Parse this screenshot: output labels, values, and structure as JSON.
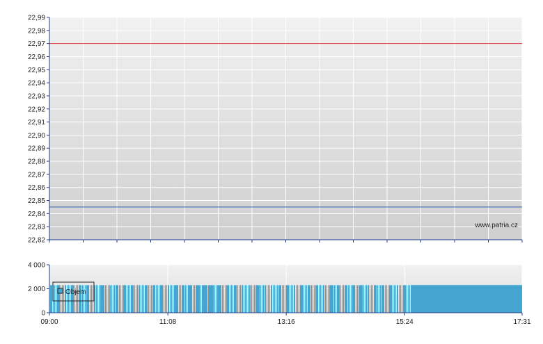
{
  "colors": {
    "price_line": "#2a64a8",
    "reference_line": "#e03030",
    "volume_bar": "#45a5cf",
    "axis": "#1d3c8c",
    "plot_bg_top": "#f1f1f1",
    "plot_bg_bottom": "#cfcfcf",
    "grid": "#ffffff"
  },
  "chart_data": [
    {
      "type": "line",
      "title": "",
      "xlabel": "",
      "ylabel": "",
      "ylim": [
        22.82,
        22.99
      ],
      "y_ticks": [
        "22,99",
        "22,98",
        "22,97",
        "22,96",
        "22,95",
        "22,94",
        "22,93",
        "22,92",
        "22,91",
        "22,90",
        "22,89",
        "22,88",
        "22,87",
        "22,86",
        "22,85",
        "22,84",
        "22,83",
        "22,82"
      ],
      "y_tick_values": [
        22.99,
        22.98,
        22.97,
        22.96,
        22.95,
        22.94,
        22.93,
        22.92,
        22.91,
        22.9,
        22.89,
        22.88,
        22.87,
        22.86,
        22.85,
        22.84,
        22.83,
        22.82
      ],
      "x_range": [
        "09:00",
        "17:31"
      ],
      "grid": true,
      "series": [
        {
          "x": [
            "09:00",
            "09:00",
            "17:31"
          ],
          "values": [
            22.945,
            22.845,
            22.845
          ]
        }
      ],
      "reference_line": {
        "value": 22.97
      },
      "watermark": "www.patria.cz"
    },
    {
      "type": "bar",
      "title": "",
      "ylim": [
        0,
        4000
      ],
      "y_ticks": [
        "4 000",
        "2 000",
        "0"
      ],
      "y_tick_values": [
        4000,
        2000,
        0
      ],
      "x_ticks": [
        "09:00",
        "11:08",
        "13:16",
        "15:24",
        "17:31"
      ],
      "x_tick_minutes": [
        540,
        668,
        796,
        924,
        1051
      ],
      "bar_value": 2300,
      "grid": true,
      "legend": {
        "position": "top-left",
        "entries": [
          "Objem"
        ]
      }
    }
  ]
}
